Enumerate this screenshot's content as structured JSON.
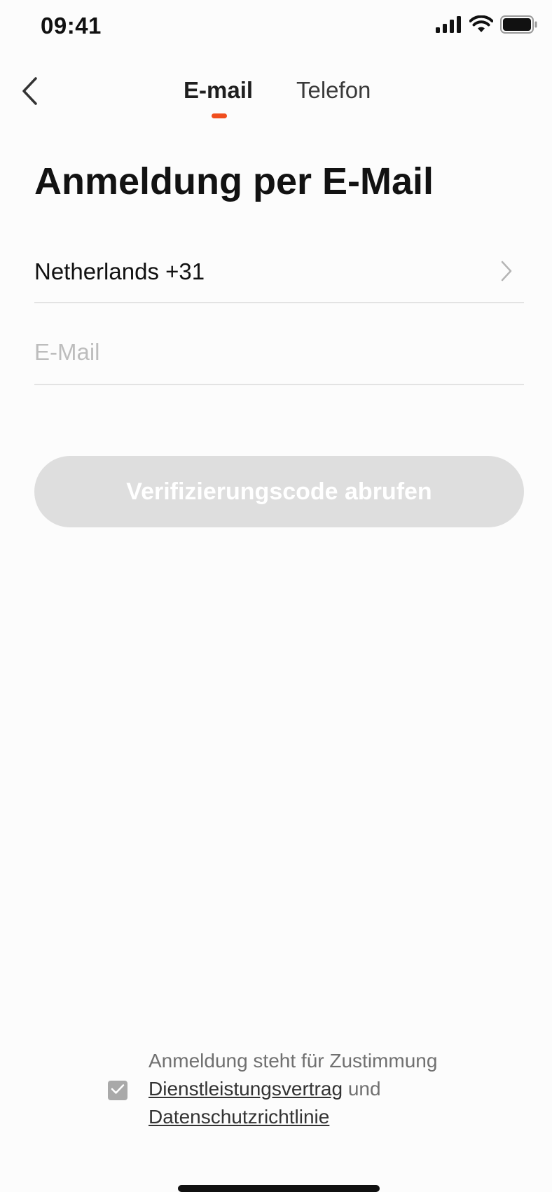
{
  "status_bar": {
    "time": "09:41"
  },
  "nav": {
    "tabs": [
      {
        "label": "E-mail",
        "active": true
      },
      {
        "label": "Telefon",
        "active": false
      }
    ],
    "accent_color": "#f04e1e"
  },
  "main": {
    "title": "Anmeldung per E-Mail",
    "country": "Netherlands +31",
    "email_placeholder": "E-Mail",
    "email_value": "",
    "verify_button_label": "Verifizierungscode abrufen"
  },
  "consent": {
    "checked": true,
    "text_line1": "Anmeldung steht für Zustimmung",
    "service_agreement": "Dienstleistungsvertrag",
    "connector": "und",
    "privacy_policy": "Datenschutzrichtlinie"
  },
  "icons": {
    "back": "chevron-left-icon",
    "country_chevron": "chevron-right-icon",
    "checkbox": "checkmark-icon",
    "signal": "signal-icon",
    "wifi": "wifi-icon",
    "battery": "battery-icon"
  }
}
